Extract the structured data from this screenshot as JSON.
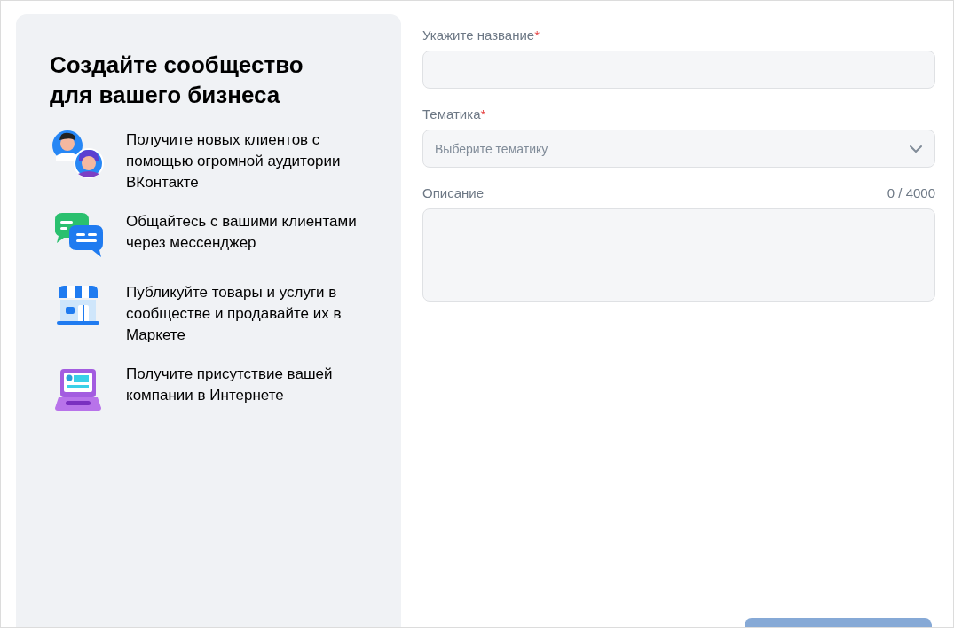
{
  "promo": {
    "title": "Создайте сообщество для вашего бизнеса",
    "features": [
      {
        "kind": "people",
        "text": "Получите новых клиентов с помощью огромной аудитории ВКонтакте"
      },
      {
        "kind": "chat",
        "text": "Общайтесь с вашими клиентами через мессенджер"
      },
      {
        "kind": "shop",
        "text": "Публикуйте товары и услуги в сообществе и продавайте их в Маркете"
      },
      {
        "kind": "laptop",
        "text": "Получите присутствие вашей компании в Интернете"
      }
    ]
  },
  "form": {
    "fields": [
      {
        "kind": "text",
        "label": "Укажите название",
        "required_mark": "*"
      },
      {
        "kind": "select",
        "label": "Тематика",
        "required_mark": "*",
        "placeholder": "Выберите тематику"
      },
      {
        "kind": "textarea",
        "label": "Описание",
        "counter": "0 / 4000"
      }
    ],
    "submit_button": {
      "disabled": true
    }
  }
}
